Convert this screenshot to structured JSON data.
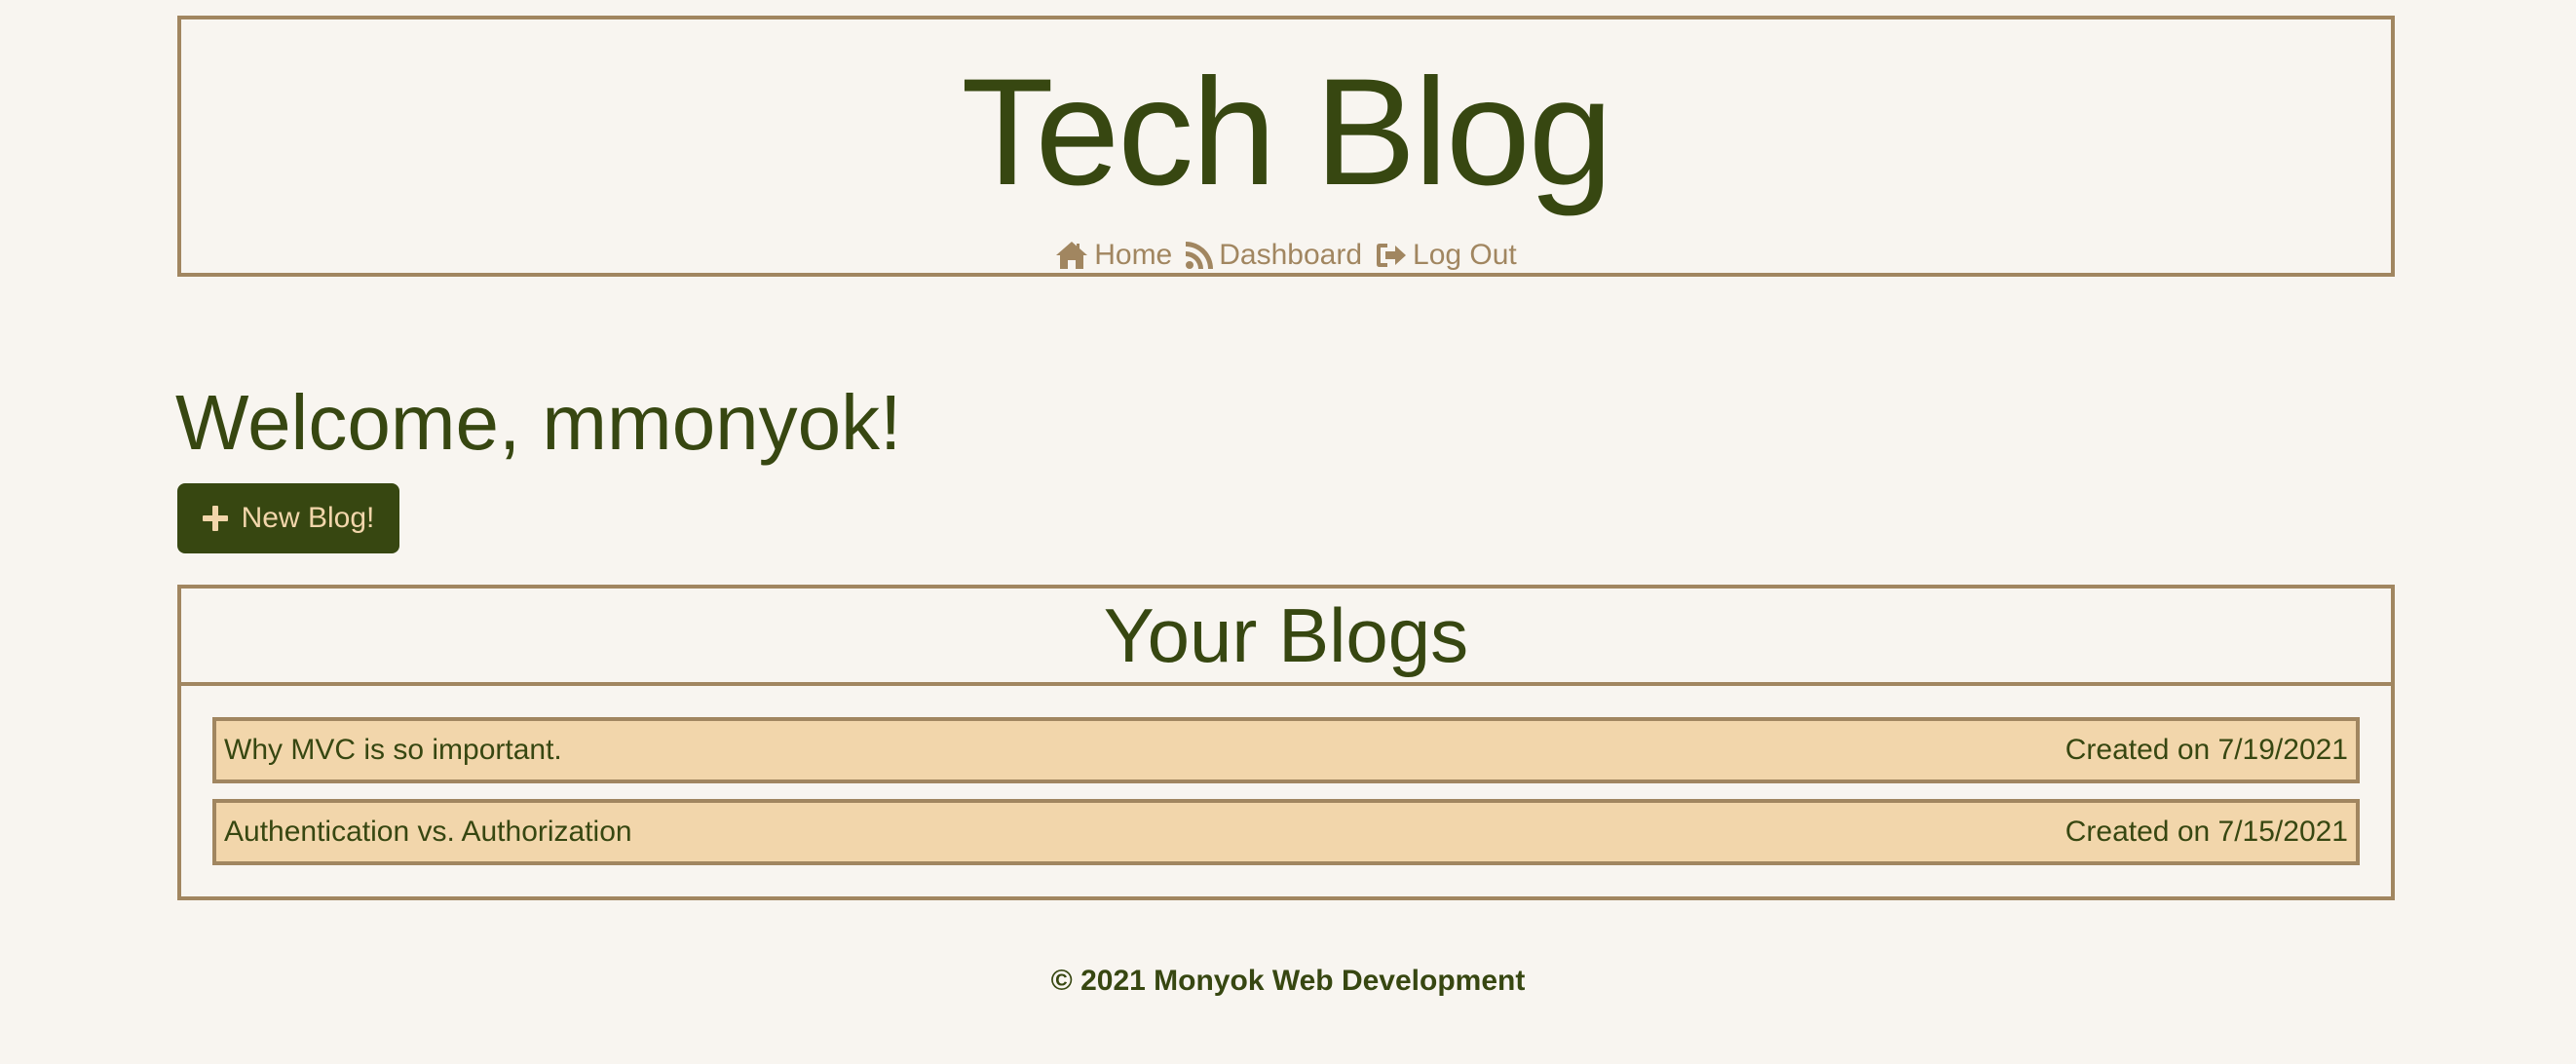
{
  "header": {
    "title": "Tech Blog",
    "nav": [
      {
        "label": "Home",
        "icon": "home-icon"
      },
      {
        "label": "Dashboard",
        "icon": "rss-icon"
      },
      {
        "label": "Log Out",
        "icon": "sign-out-icon"
      }
    ]
  },
  "dashboard": {
    "welcome": "Welcome, mmonyok!",
    "new_blog_label": "New Blog!",
    "new_blog_icon": "plus-icon"
  },
  "blogs": {
    "heading": "Your Blogs",
    "items": [
      {
        "title": "Why MVC is so important.",
        "created": "Created on 7/19/2021"
      },
      {
        "title": "Authentication vs. Authorization",
        "created": "Created on 7/15/2021"
      }
    ]
  },
  "footer": {
    "text": "© 2021 Monyok Web Development"
  },
  "colors": {
    "background": "#f8f5f0",
    "primary": "#374711",
    "accent": "#a18660",
    "row_fill": "#f2d6ab"
  }
}
